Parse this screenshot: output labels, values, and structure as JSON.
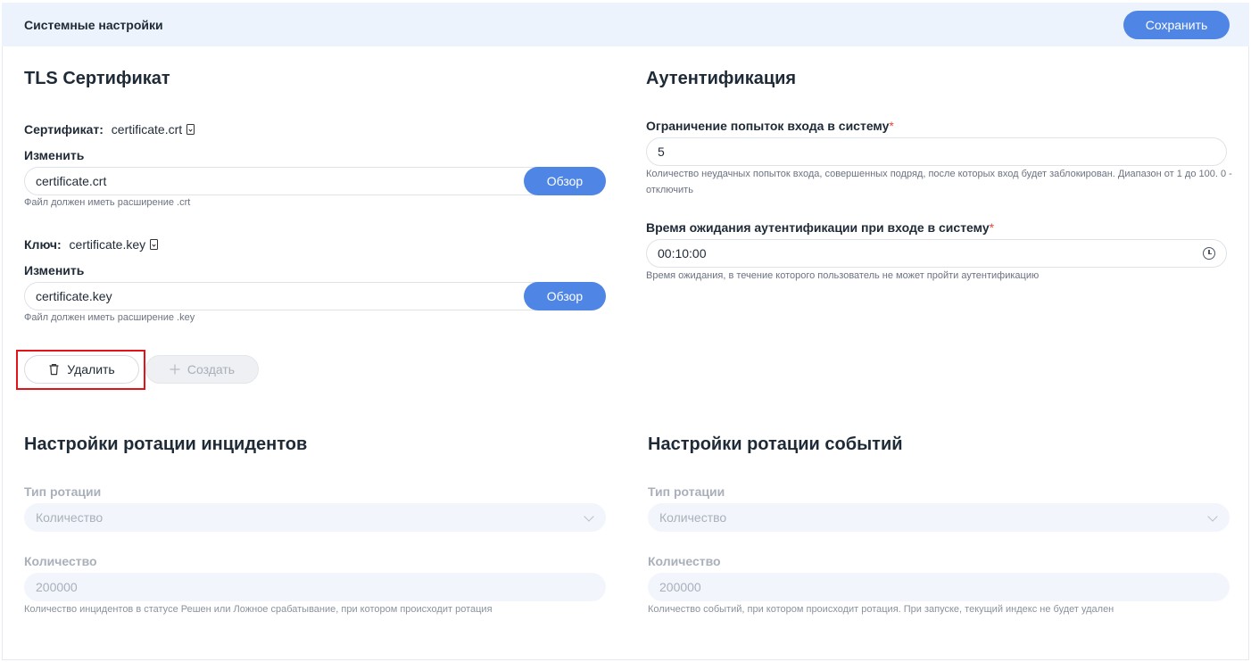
{
  "header": {
    "title": "Системные настройки",
    "save_label": "Сохранить"
  },
  "tls": {
    "title": "TLS Сертификат",
    "cert_label": "Сертификат:",
    "cert_file": "certificate.crt",
    "cert_change_label": "Изменить",
    "cert_input_value": "certificate.crt",
    "cert_browse_label": "Обзор",
    "cert_help": "Файл должен иметь расширение .crt",
    "key_label": "Ключ:",
    "key_file": "certificate.key",
    "key_change_label": "Изменить",
    "key_input_value": "certificate.key",
    "key_browse_label": "Обзор",
    "key_help": "Файл должен иметь расширение .key",
    "delete_label": "Удалить",
    "create_label": "Создать"
  },
  "auth": {
    "title": "Аутентификация",
    "attempts_label": "Ограничение попыток входа в систему",
    "attempts_value": "5",
    "attempts_help": "Количество неудачных попыток входа, совершенных подряд, после которых вход будет заблокирован. Диапазон от 1 до 100. 0 - отключить",
    "timeout_label": "Время ожидания аутентификации при входе в систему",
    "timeout_value": "00:10:00",
    "timeout_help": "Время ожидания, в течение которого пользователь не может пройти аутентификацию",
    "required_mark": "*"
  },
  "incidents": {
    "title": "Настройки ротации инцидентов",
    "type_label": "Тип ротации",
    "type_value": "Количество",
    "count_label": "Количество",
    "count_value": "200000",
    "count_help": "Количество инцидентов в статусе Решен или Ложное срабатывание, при котором происходит ротация"
  },
  "events": {
    "title": "Настройки ротации событий",
    "type_label": "Тип ротации",
    "type_value": "Количество",
    "count_label": "Количество",
    "count_value": "200000",
    "count_help": "Количество событий, при котором происходит ротация. При запуске, текущий индекс не будет удален"
  },
  "colors": {
    "accent": "#4f86e6",
    "header_bg": "#ecf3fc",
    "highlight": "#e0141a",
    "required": "#e5483d"
  }
}
